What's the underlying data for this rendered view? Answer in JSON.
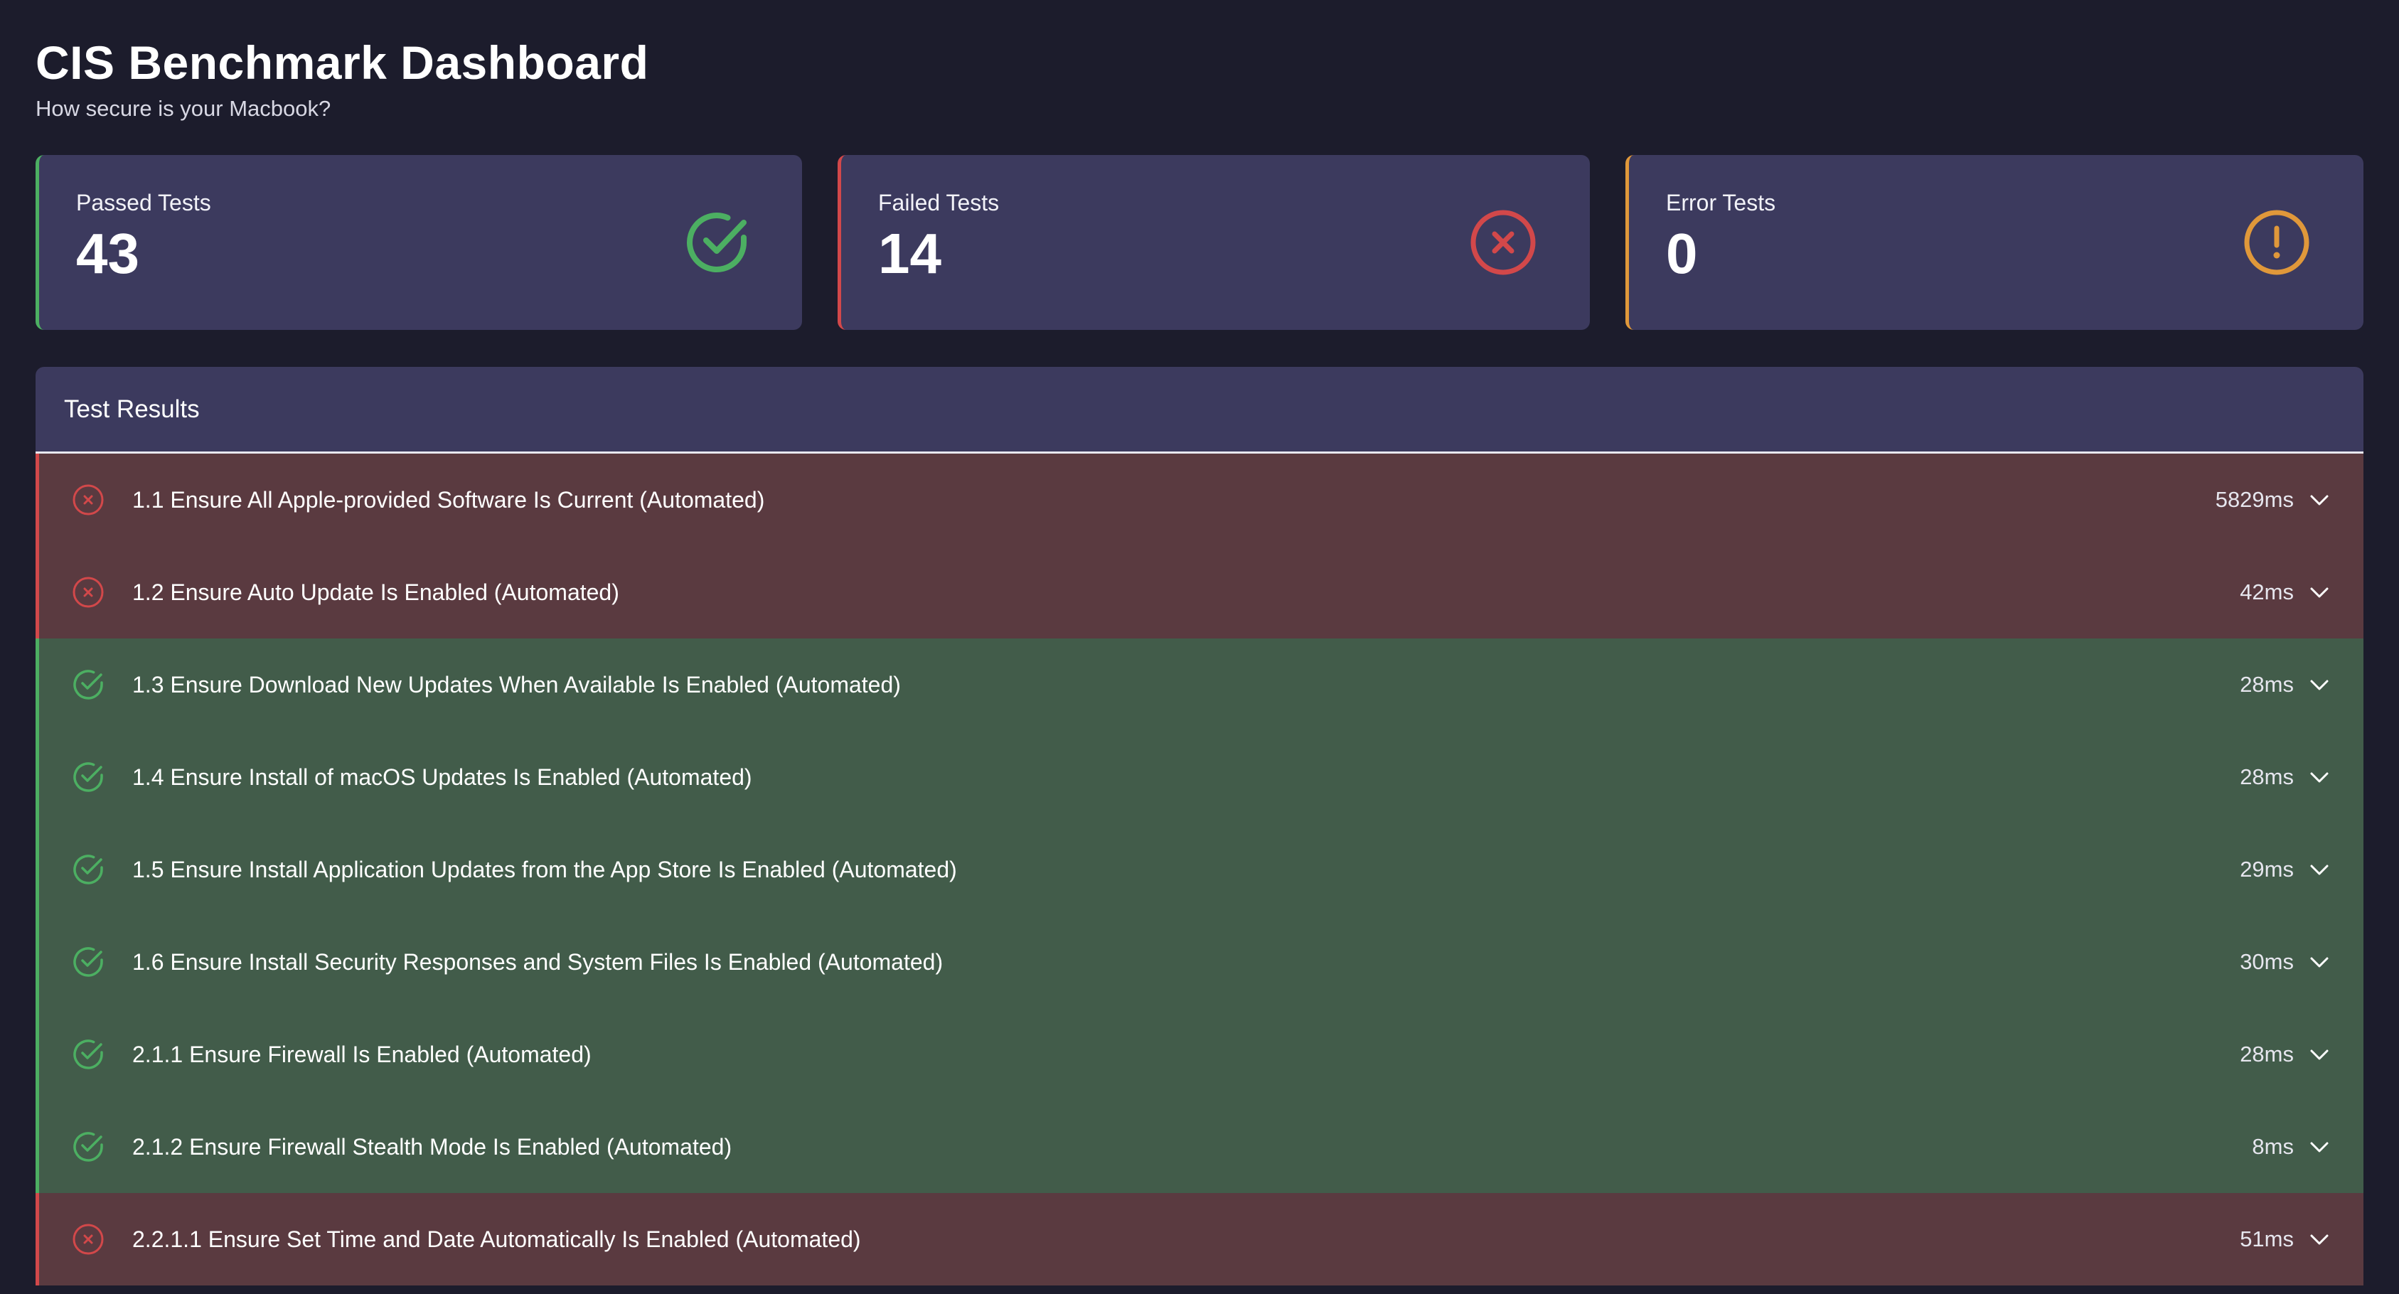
{
  "header": {
    "title": "CIS Benchmark Dashboard",
    "subtitle": "How secure is your Macbook?"
  },
  "summary": {
    "passed": {
      "label": "Passed Tests",
      "value": "43",
      "icon": "check-circle-icon",
      "color": "#4caf62"
    },
    "failed": {
      "label": "Failed Tests",
      "value": "14",
      "icon": "x-circle-icon",
      "color": "#d2484a"
    },
    "errors": {
      "label": "Error Tests",
      "value": "0",
      "icon": "exclamation-circle-icon",
      "color": "#e0983a"
    }
  },
  "results": {
    "title": "Test Results",
    "rows": [
      {
        "status": "fail",
        "name": "1.1 Ensure All Apple-provided Software Is Current (Automated)",
        "duration": "5829ms"
      },
      {
        "status": "fail",
        "name": "1.2 Ensure Auto Update Is Enabled (Automated)",
        "duration": "42ms"
      },
      {
        "status": "pass",
        "name": "1.3 Ensure Download New Updates When Available Is Enabled (Automated)",
        "duration": "28ms"
      },
      {
        "status": "pass",
        "name": "1.4 Ensure Install of macOS Updates Is Enabled (Automated)",
        "duration": "28ms"
      },
      {
        "status": "pass",
        "name": "1.5 Ensure Install Application Updates from the App Store Is Enabled (Automated)",
        "duration": "29ms"
      },
      {
        "status": "pass",
        "name": "1.6 Ensure Install Security Responses and System Files Is Enabled (Automated)",
        "duration": "30ms"
      },
      {
        "status": "pass",
        "name": "2.1.1 Ensure Firewall Is Enabled (Automated)",
        "duration": "28ms"
      },
      {
        "status": "pass",
        "name": "2.1.2 Ensure Firewall Stealth Mode Is Enabled (Automated)",
        "duration": "8ms"
      },
      {
        "status": "fail",
        "name": "2.2.1.1 Ensure Set Time and Date Automatically Is Enabled (Automated)",
        "duration": "51ms"
      }
    ]
  },
  "colors": {
    "background": "#1c1c2c",
    "card": "#3c3a5e",
    "fail_row": "#5a3a40",
    "pass_row": "#425c4a"
  }
}
